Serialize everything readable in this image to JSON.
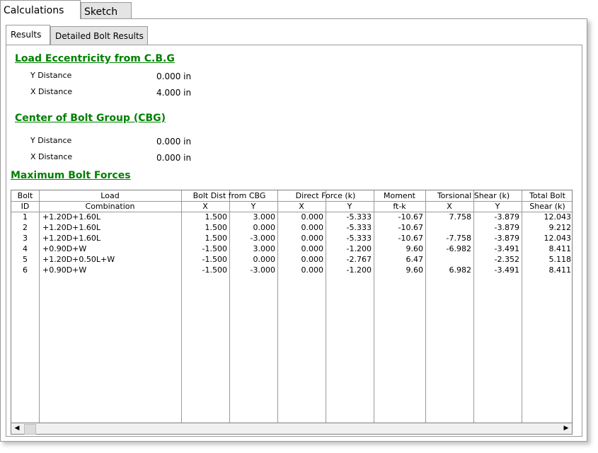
{
  "tabs": {
    "outer": [
      "Calculations",
      "Sketch"
    ],
    "inner": [
      "Results",
      "Detailed Bolt Results"
    ]
  },
  "load_eccentricity": {
    "title": "Load Eccentricity from C.B.G",
    "y_label": "Y Distance",
    "y_value": "0.000 in",
    "x_label": "X Distance",
    "x_value": "4.000 in"
  },
  "cbg": {
    "title": "Center of Bolt Group (CBG)",
    "y_label": "Y Distance",
    "y_value": "0.000 in",
    "x_label": "X Distance",
    "x_value": "0.000 in"
  },
  "max_forces": {
    "title": "Maximum Bolt Forces",
    "headers_top": [
      "Bolt",
      "Load",
      "Bolt Dist from CBG",
      "Direct Force  (k)",
      "Moment",
      "Torsional Shear  (k)",
      "Total Bolt"
    ],
    "headers_bottom": [
      "ID",
      "Combination",
      "X",
      "Y",
      "X",
      "Y",
      "ft-k",
      "X",
      "Y",
      "Shear  (k)"
    ],
    "rows": [
      [
        "1",
        "+1.20D+1.60L",
        "1.500",
        "3.000",
        "0.000",
        "-5.333",
        "-10.67",
        "7.758",
        "-3.879",
        "12.043"
      ],
      [
        "2",
        "+1.20D+1.60L",
        "1.500",
        "0.000",
        "0.000",
        "-5.333",
        "-10.67",
        "",
        "-3.879",
        "9.212"
      ],
      [
        "3",
        "+1.20D+1.60L",
        "1.500",
        "-3.000",
        "0.000",
        "-5.333",
        "-10.67",
        "-7.758",
        "-3.879",
        "12.043"
      ],
      [
        "4",
        "+0.90D+W",
        "-1.500",
        "3.000",
        "0.000",
        "-1.200",
        "9.60",
        "-6.982",
        "-3.491",
        "8.411"
      ],
      [
        "5",
        "+1.20D+0.50L+W",
        "-1.500",
        "0.000",
        "0.000",
        "-2.767",
        "6.47",
        "",
        "-2.352",
        "5.118"
      ],
      [
        "6",
        "+0.90D+W",
        "-1.500",
        "-3.000",
        "0.000",
        "-1.200",
        "9.60",
        "6.982",
        "-3.491",
        "8.411"
      ]
    ]
  },
  "colors": {
    "section_title": "#008000"
  }
}
